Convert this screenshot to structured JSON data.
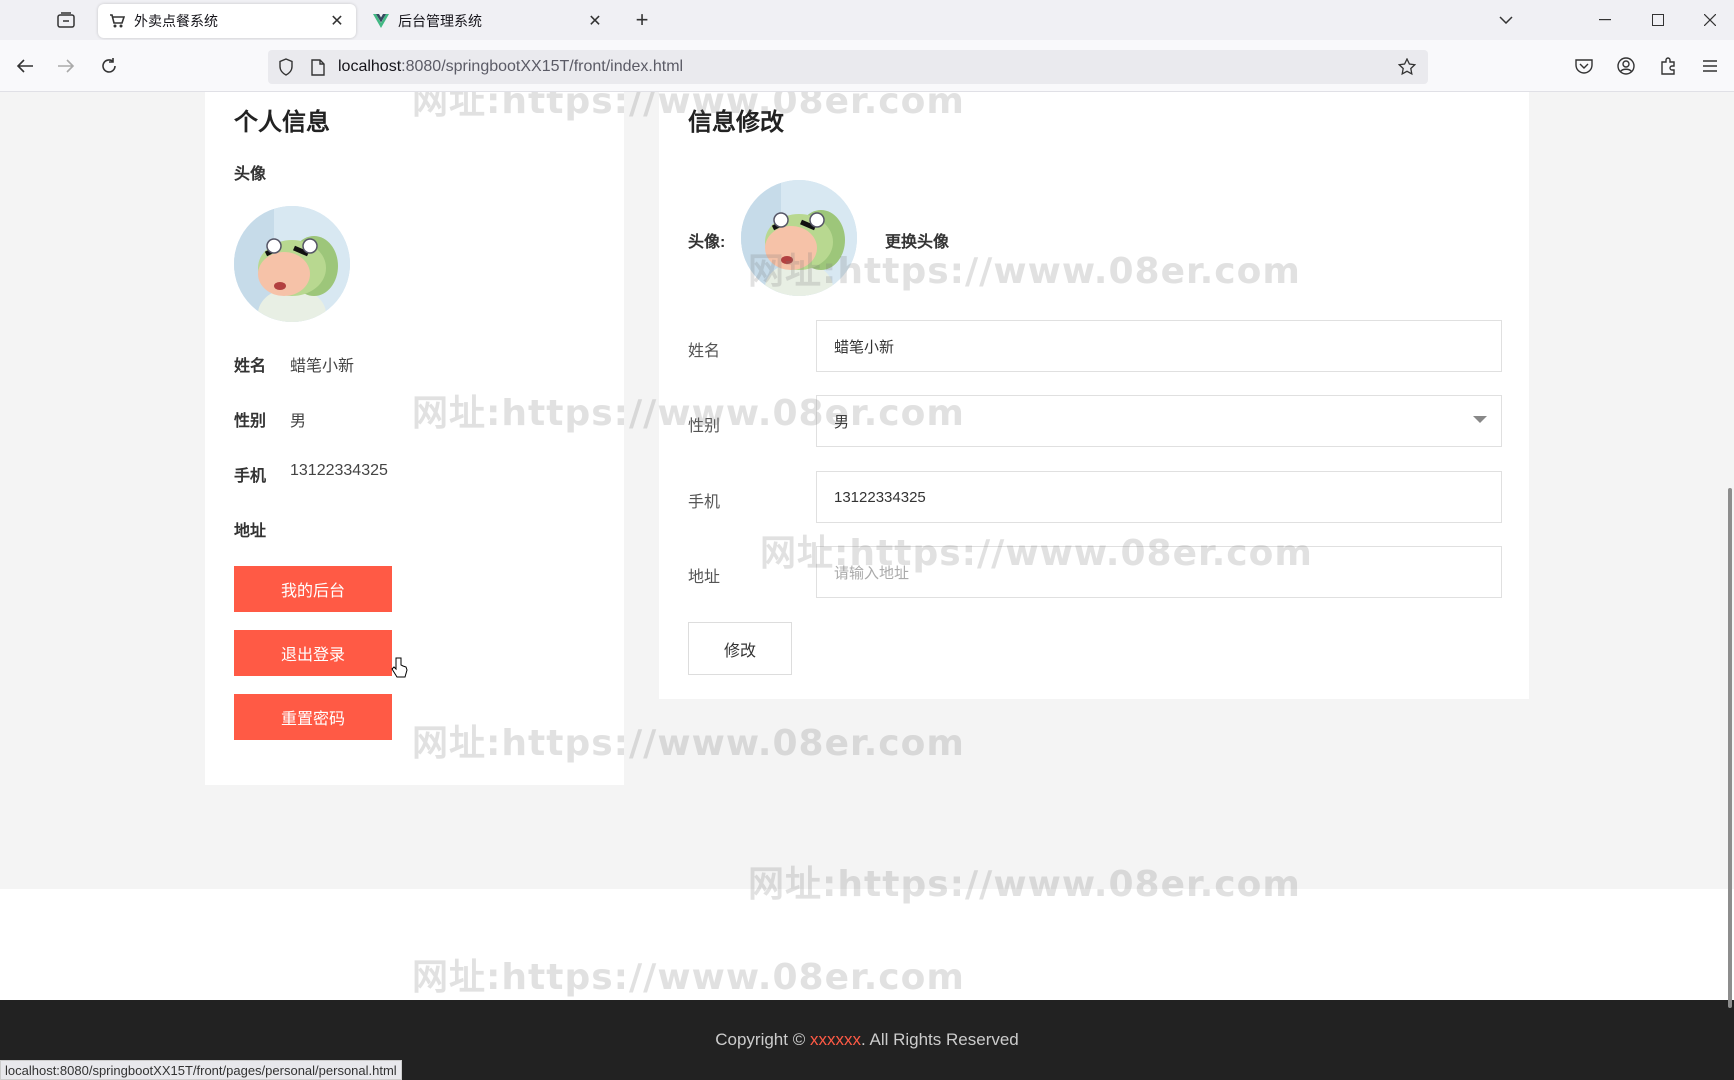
{
  "browser": {
    "tabs": [
      {
        "title": "外卖点餐系统",
        "icon": "cart-icon",
        "active": true
      },
      {
        "title": "后台管理系统",
        "icon": "vue-logo-icon",
        "active": false
      }
    ],
    "url_host": "localhost",
    "url_path": ":8080/springbootXX15T/front/index.html",
    "status_url": "localhost:8080/springbootXX15T/front/pages/personal/personal.html"
  },
  "left": {
    "title": "个人信息",
    "avatar_label": "头像",
    "name_label": "姓名",
    "name_value": "蜡笔小新",
    "gender_label": "性别",
    "gender_value": "男",
    "phone_label": "手机",
    "phone_value": "13122334325",
    "address_label": "地址",
    "buttons": {
      "backend": "我的后台",
      "logout": "退出登录",
      "reset_password": "重置密码"
    }
  },
  "right": {
    "title": "信息修改",
    "avatar_label": "头像:",
    "change_avatar": "更换头像",
    "name_label": "姓名",
    "name_value": "蜡笔小新",
    "gender_label": "性别",
    "gender_value": "男",
    "phone_label": "手机",
    "phone_value": "13122334325",
    "address_label": "地址",
    "address_placeholder": "请输入地址",
    "submit": "修改"
  },
  "footer": {
    "prefix": "Copyright © ",
    "brand": "xxxxxx",
    "suffix": ". All Rights Reserved"
  },
  "watermark": "网址:https://www.08er.com",
  "colors": {
    "accent": "#ff5a45",
    "footer_bg": "#222222",
    "page_bg": "#f4f4f4"
  }
}
